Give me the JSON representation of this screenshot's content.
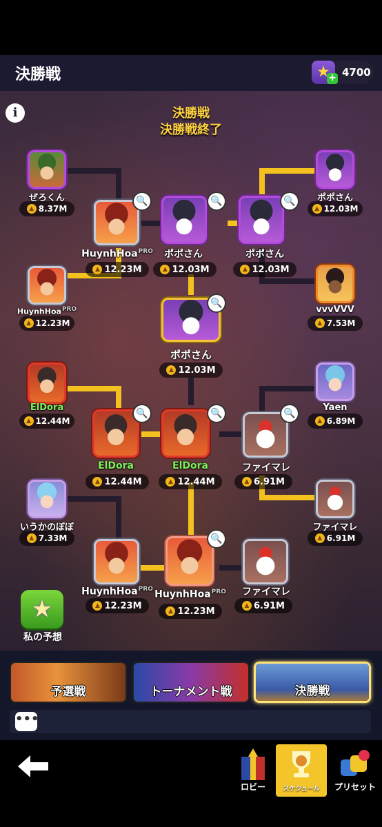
{
  "header": {
    "title": "決勝戦",
    "currency_value": "4700"
  },
  "stage": {
    "title": "決勝戦",
    "status": "決勝戦終了"
  },
  "players": {
    "zero": {
      "name": "ぜろくん",
      "score": "8.37M"
    },
    "popo_r1": {
      "name": "ポポさん",
      "score": "12.03M"
    },
    "huynh_r1a": {
      "name": "HuynhHoa",
      "badge": "PRO",
      "score": "12.23M"
    },
    "huynh_qf": {
      "name": "HuynhHoa",
      "badge": "PRO",
      "score": "12.23M"
    },
    "popo_sf_left": {
      "name": "ポポさん",
      "score": "12.03M"
    },
    "popo_sf_right": {
      "name": "ポポさん",
      "score": "12.03M"
    },
    "vvv": {
      "name": "vvvVVV",
      "score": "7.53M"
    },
    "popo_champion": {
      "name": "ポポさん",
      "score": "12.03M"
    },
    "eldora_r1": {
      "name": "ElDora",
      "score": "12.44M"
    },
    "yaen": {
      "name": "Yaen",
      "score": "6.89M"
    },
    "eldora_qf": {
      "name": "ElDora",
      "score": "12.44M"
    },
    "eldora_sf": {
      "name": "ElDora",
      "score": "12.44M"
    },
    "faimare_sf": {
      "name": "ファイマレ",
      "score": "6.91M"
    },
    "iuka": {
      "name": "いうかのぼぼ",
      "score": "7.33M"
    },
    "faimare_r1": {
      "name": "ファイマレ",
      "score": "6.91M"
    },
    "huynh_r1b": {
      "name": "HuynhHoa",
      "badge": "PRO",
      "score": "12.23M"
    },
    "huynh_sf": {
      "name": "HuynhHoa",
      "badge": "PRO",
      "score": "12.23M"
    },
    "faimare_qf": {
      "name": "ファイマレ",
      "score": "6.91M"
    }
  },
  "prediction": {
    "label": "私の予想"
  },
  "tabs": [
    {
      "label": "予選戦"
    },
    {
      "label": "トーナメント戦"
    },
    {
      "label": "決勝戦"
    }
  ],
  "chat": {
    "icon": "•••"
  },
  "nav": {
    "lobby": "ロビー",
    "schedule": "スケジュール",
    "preset": "プリセット"
  },
  "colors": {
    "accent_gold": "#f4c21f",
    "winner_green": "#7ef05a",
    "active_tab": "#ffe27a"
  }
}
